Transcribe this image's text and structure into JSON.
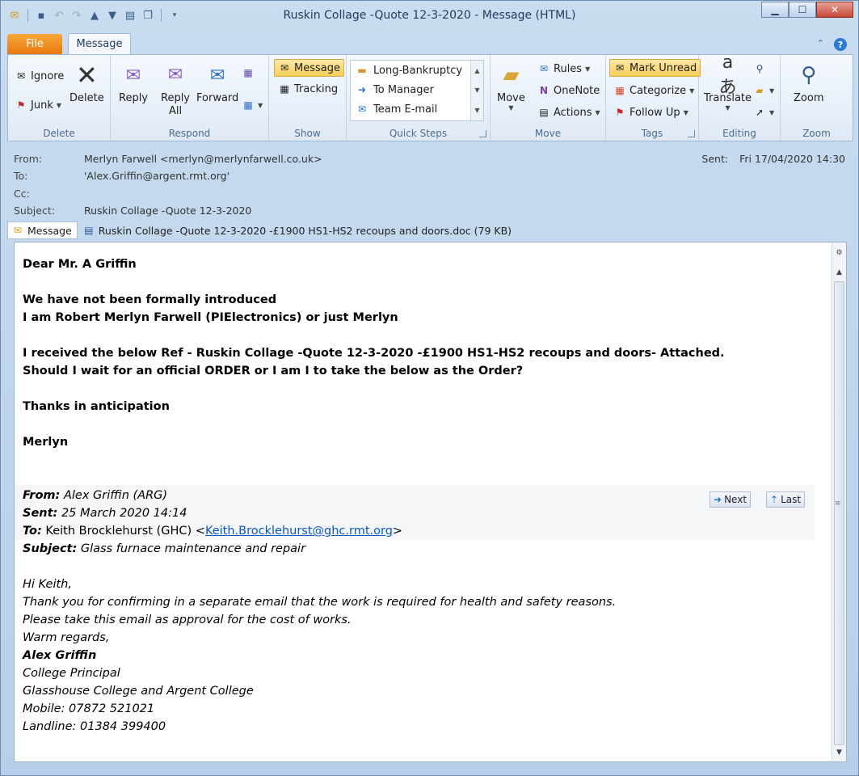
{
  "window": {
    "title": "Ruskin Collage -Quote 12-3-2020  -  Message (HTML)"
  },
  "ribbon_tabs": {
    "file": "File",
    "message": "Message"
  },
  "groups": {
    "delete": {
      "name": "Delete",
      "ignore": "Ignore",
      "junk": "Junk",
      "delete": "Delete"
    },
    "respond": {
      "name": "Respond",
      "reply": "Reply",
      "reply_all_1": "Reply",
      "reply_all_2": "All",
      "forward": "Forward"
    },
    "show": {
      "name": "Show",
      "message": "Message",
      "tracking": "Tracking"
    },
    "quick_steps": {
      "name": "Quick Steps",
      "items": [
        "Long-Bankruptcy",
        "To Manager",
        "Team E-mail"
      ]
    },
    "move": {
      "name": "Move",
      "move": "Move",
      "rules": "Rules",
      "onenote": "OneNote",
      "actions": "Actions"
    },
    "tags": {
      "name": "Tags",
      "mark_unread": "Mark Unread",
      "categorize": "Categorize",
      "follow_up": "Follow Up"
    },
    "editing": {
      "name": "Editing",
      "translate": "Translate"
    },
    "zoom": {
      "name": "Zoom",
      "zoom": "Zoom"
    }
  },
  "header": {
    "from_label": "From:",
    "from": "Merlyn Farwell <merlyn@merlynfarwell.co.uk>",
    "to_label": "To:",
    "to": "'Alex.Griffin@argent.rmt.org'",
    "cc_label": "Cc:",
    "subject_label": "Subject:",
    "subject": "Ruskin Collage -Quote 12-3-2020",
    "sent_label": "Sent:",
    "sent": "Fri 17/04/2020 14:30"
  },
  "attachments": {
    "message_tab": "Message",
    "file": "Ruskin Collage -Quote 12-3-2020   -£1900 HS1-HS2 recoups and doors.doc (79 KB)"
  },
  "body": {
    "greeting": "Dear Mr. A Griffin",
    "line1": "We have not been formally introduced",
    "line2": "I am Robert Merlyn Farwell (PIElectronics)  or just Merlyn",
    "line3": "I received the below Ref - Ruskin Collage -Quote 12-3-2020   -£1900 HS1-HS2 recoups and doors- Attached.",
    "line4": "Should I wait for an official ORDER or I am I to take the below as the Order?",
    "thanks": "Thanks in anticipation",
    "sign": "Merlyn"
  },
  "forwarded": {
    "from_label": "From:",
    "from": " Alex Griffin (ARG)",
    "sent_label": "Sent:",
    "sent": " 25 March 2020 14:14",
    "to_label": "To:",
    "to_name": " Keith Brocklehurst (GHC) <",
    "to_email": "Keith.Brocklehurst@ghc.rmt.org",
    "to_end": ">",
    "subject_label": "Subject:",
    "subject": " Glass furnace maintenance and repair",
    "next": "Next",
    "last": "Last",
    "lines": [
      "Hi Keith,",
      "Thank you for confirming in a separate email that the work is required for health and safety reasons.",
      "Please take this email as approval for the cost of works.",
      "Warm regards,"
    ],
    "sig_name": "Alex Griffin",
    "sig_lines": [
      "College Principal",
      "Glasshouse College and Argent College",
      "Mobile: 07872 521021",
      "Landline: 01384 399400"
    ]
  }
}
